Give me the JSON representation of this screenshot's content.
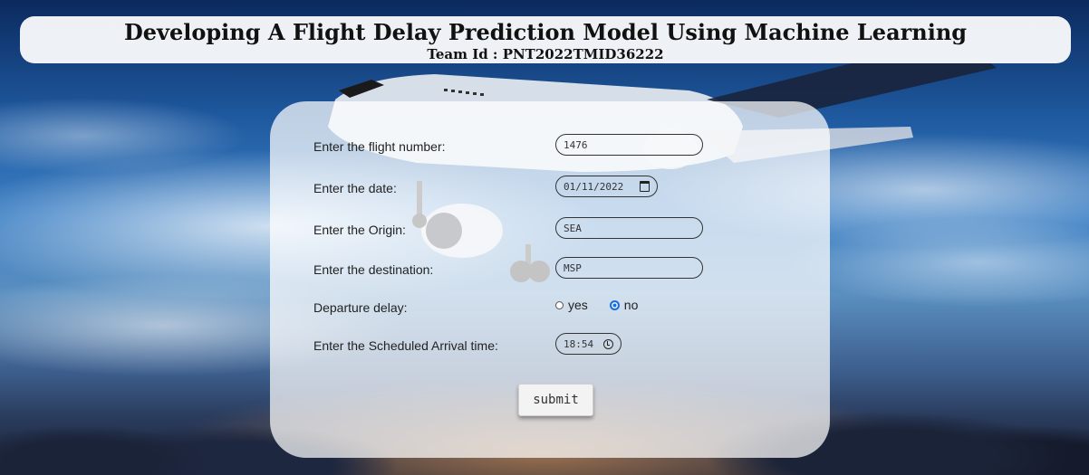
{
  "header": {
    "title": "Developing A Flight Delay Prediction Model Using Machine Learning",
    "team_id": "Team Id : PNT2022TMID36222"
  },
  "form": {
    "flight_number": {
      "label": "Enter the flight number:",
      "value": "1476"
    },
    "date": {
      "label": "Enter the date:",
      "value": "01/11/2022",
      "icon": "calendar-icon"
    },
    "origin": {
      "label": "Enter the Origin:",
      "value": "SEA"
    },
    "destination": {
      "label": "Enter the destination:",
      "value": "MSP"
    },
    "departure_delay": {
      "label": "Departure delay:",
      "options": [
        "yes",
        "no"
      ],
      "selected": "no"
    },
    "arrival_time": {
      "label": "Enter the Scheduled Arrival time:",
      "value": "18:54",
      "icon": "clock-icon"
    },
    "submit_label": "submit"
  },
  "colors": {
    "radio_accent": "#1a6fe0",
    "card_background": "rgba(255,255,255,0.72)"
  }
}
